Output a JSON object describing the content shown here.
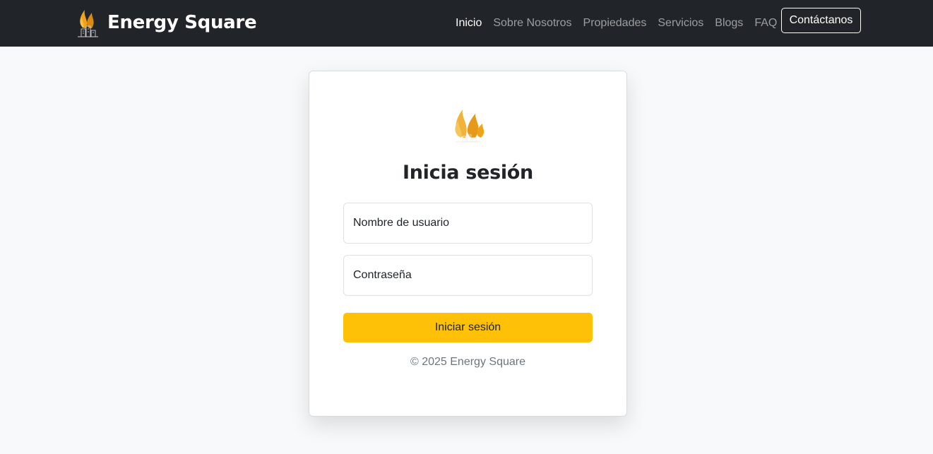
{
  "navbar": {
    "brand_icon": "flame-building-icon",
    "brand_name": "Energy Square",
    "links": [
      {
        "label": "Inicio",
        "active": true
      },
      {
        "label": "Sobre Nosotros",
        "active": false
      },
      {
        "label": "Propiedades",
        "active": false
      },
      {
        "label": "Servicios",
        "active": false
      },
      {
        "label": "Blogs",
        "active": false
      },
      {
        "label": "FAQ",
        "active": false
      }
    ],
    "contact_label": "Contáctanos"
  },
  "login": {
    "logo_icon": "flame-logo-icon",
    "title": "Inicia sesión",
    "username_label": "Nombre de usuario",
    "password_label": "Contraseña",
    "submit_label": "Iniciar sesión",
    "copyright": "© 2025 Energy Square"
  },
  "colors": {
    "navbar_bg": "#212529",
    "page_bg": "#f8f9fa",
    "accent": "#ffc107",
    "flame": "#f0a21a"
  }
}
